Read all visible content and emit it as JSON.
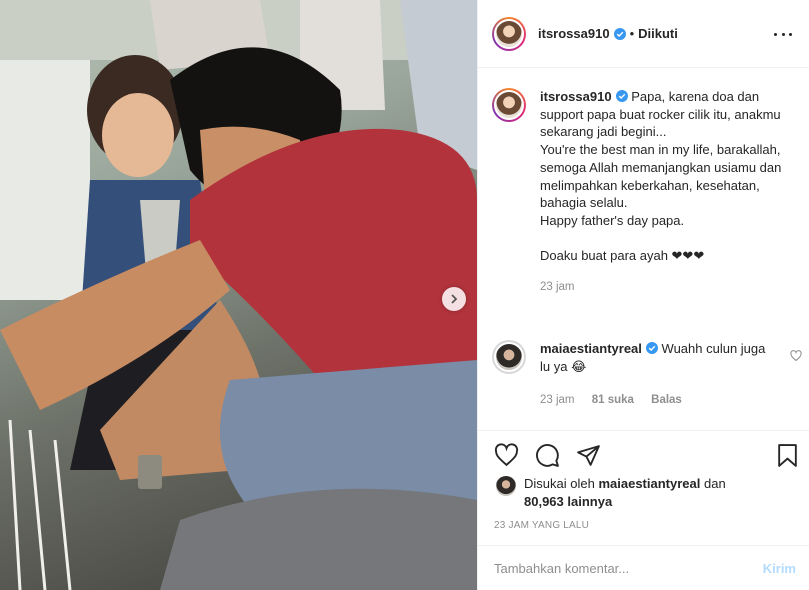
{
  "post": {
    "username": "itsrossa910",
    "follow_state": "Diikuti",
    "separator": "•"
  },
  "caption": {
    "username": "itsrossa910",
    "lines": [
      "Papa, karena doa dan support papa buat rocker cilik itu, anakmu sekarang jadi begini...",
      "You're the best man in my life, barakallah, semoga Allah memanjangkan usiamu dan melimpahkan keberkahan, kesehatan, bahagia selalu.",
      "Happy father's day papa.",
      "Doaku buat para ayah ❤❤❤"
    ],
    "time": "23 jam"
  },
  "comment": {
    "username": "maiaestiantyreal",
    "text": "Wuahh culun juga lu ya 😂",
    "time": "23 jam",
    "likes": "81 suka",
    "reply_label": "Balas"
  },
  "likes": {
    "prefix": "Disukai oleh",
    "user": "maiaestiantyreal",
    "joiner": "dan",
    "count": "80,963 lainnya"
  },
  "timestamp": "23 JAM YANG LALU",
  "add_comment": {
    "placeholder": "Tambahkan komentar...",
    "post_label": "Kirim"
  },
  "icons": {
    "verified": "verified-badge-icon",
    "like": "heart-icon",
    "comment": "comment-bubble-icon",
    "share": "paper-plane-icon",
    "save": "bookmark-icon",
    "more": "more-horizontal-icon",
    "next": "chevron-right-icon"
  },
  "colors": {
    "verified": "#3897f0",
    "post_button_disabled": "#b3dbff",
    "muted_text": "#8e8e8e",
    "border": "#efefef"
  }
}
